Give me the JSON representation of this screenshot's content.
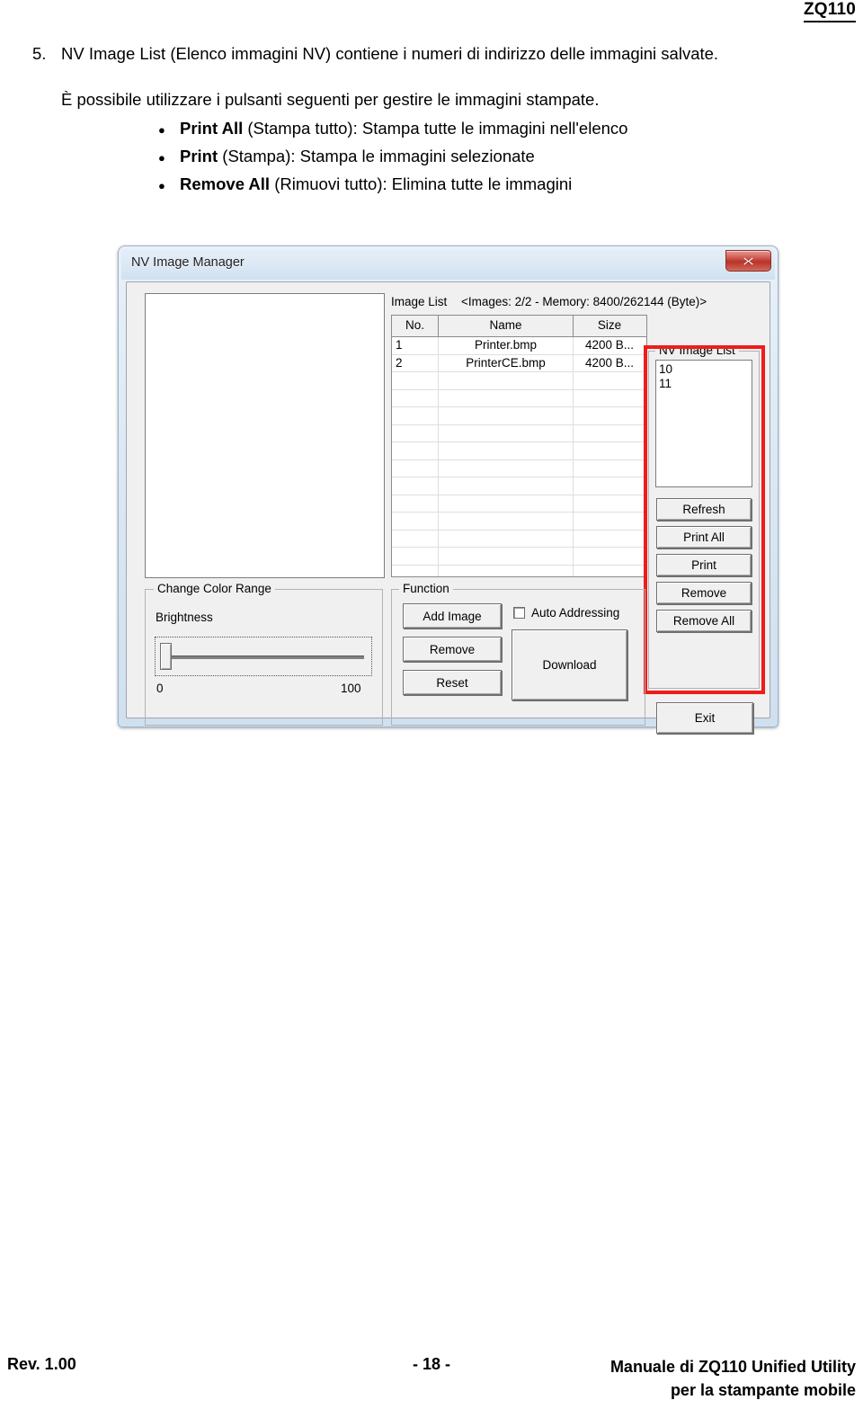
{
  "page": {
    "header_title": "ZQ110",
    "numbered_item": {
      "number": "5.",
      "text": "NV Image List (Elenco immagini NV) contiene i numeri di indirizzo delle immagini salvate."
    },
    "intro_paragraph": "È possibile utilizzare i pulsanti seguenti per gestire le immagini stampate.",
    "bullets": [
      {
        "bold": "Print All",
        "rest": " (Stampa tutto): Stampa tutte le immagini nell'elenco"
      },
      {
        "bold": "Print",
        "rest": " (Stampa): Stampa le immagini selezionate"
      },
      {
        "bold": "Remove All",
        "rest": " (Rimuovi tutto): Elimina tutte le immagini"
      }
    ]
  },
  "dialog": {
    "title": "NV Image Manager",
    "close_label": "x",
    "image_list": {
      "label": "Image List",
      "meta": "<Images: 2/2 - Memory: 8400/262144 (Byte)>",
      "columns": [
        "No.",
        "Name",
        "Size"
      ],
      "rows": [
        {
          "no": "1",
          "name": "Printer.bmp",
          "size": "4200 B..."
        },
        {
          "no": "2",
          "name": "PrinterCE.bmp",
          "size": "4200 B..."
        }
      ]
    },
    "nv_image_list": {
      "group_title": "NV Image List",
      "items": [
        "10",
        "11"
      ],
      "buttons": {
        "refresh": "Refresh",
        "print_all": "Print All",
        "print": "Print",
        "remove": "Remove",
        "remove_all": "Remove All"
      },
      "highlight_color": "#ee1c1c"
    },
    "exit_button": "Exit",
    "change_color_range": {
      "group_title": "Change Color Range",
      "slider_label": "Brightness",
      "scale_min": "0",
      "scale_max": "100",
      "slider_value": "0"
    },
    "function": {
      "group_title": "Function",
      "add_image": "Add Image",
      "remove": "Remove",
      "reset": "Reset",
      "auto_addressing": "Auto Addressing",
      "auto_addressing_checked": false,
      "download": "Download"
    }
  },
  "footer": {
    "left": "Rev. 1.00",
    "center": "- 18 -",
    "right_line1": "Manuale di ZQ110 Unified Utility",
    "right_line2": "per la stampante mobile"
  }
}
